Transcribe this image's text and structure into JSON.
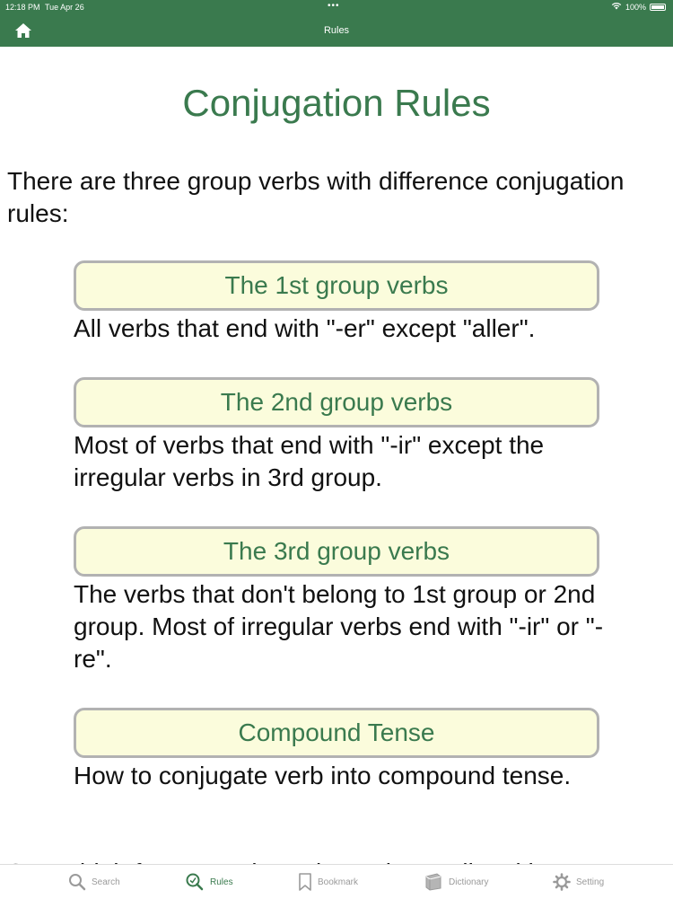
{
  "status": {
    "time": "12:18 PM",
    "date": "Tue Apr 26",
    "battery": "100%"
  },
  "nav": {
    "title": "Rules"
  },
  "page": {
    "title": "Conjugation Rules",
    "intro": "There are three group verbs with difference conjugation rules:",
    "rules": [
      {
        "button": "The 1st group verbs",
        "description": "All verbs that end with \"-er\" except \"aller\"."
      },
      {
        "button": "The 2nd group verbs",
        "description": "Most of verbs that end with \"-ir\" except the irregular verbs in 3rd group."
      },
      {
        "button": "The 3rd group verbs",
        "description": "The verbs that don't belong to 1st group or 2nd group. Most of irregular verbs end with \"-ir\" or \"-re\"."
      },
      {
        "button": "Compound Tense",
        "description": "How to conjugate verb into compound tense."
      }
    ],
    "cutoff_text": "Some high frequency irregular verbs are listed here:"
  },
  "tabs": [
    {
      "label": "Search",
      "icon": "search-icon"
    },
    {
      "label": "Rules",
      "icon": "rules-icon",
      "active": true
    },
    {
      "label": "Bookmark",
      "icon": "bookmark-icon"
    },
    {
      "label": "Dictionary",
      "icon": "dictionary-icon"
    },
    {
      "label": "Setting",
      "icon": "gear-icon"
    }
  ],
  "colors": {
    "accent": "#3a7a4e",
    "button_bg": "#fbfcdc",
    "button_border": "#b2b2b2",
    "tab_inactive": "#9a9a9a"
  }
}
